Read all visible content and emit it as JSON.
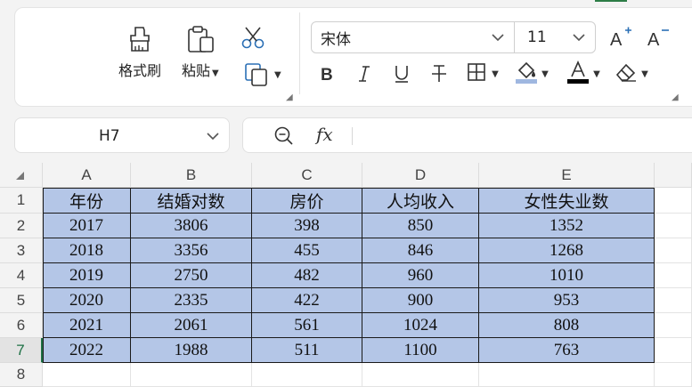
{
  "ribbon": {
    "format_painter_label": "格式刷",
    "paste_label": "粘贴",
    "font_name": "宋体",
    "font_size": "11",
    "icons": [
      "format-painter-icon",
      "paste-icon",
      "cut-icon",
      "copy-icon",
      "grow-font-icon",
      "shrink-font-icon",
      "bold-icon",
      "italic-icon",
      "underline-icon",
      "strikethrough-icon",
      "borders-icon",
      "fill-color-icon",
      "font-color-icon",
      "clear-icon"
    ],
    "colors": {
      "fill_swatch": "#9fb7e0",
      "font_color_swatch": "#000000"
    }
  },
  "namebox": {
    "value": "H7"
  },
  "formula": {
    "fx_label": "fx",
    "value": ""
  },
  "sheet": {
    "columns": [
      "A",
      "B",
      "C",
      "D",
      "E"
    ],
    "rows": [
      "1",
      "2",
      "3",
      "4",
      "5",
      "6",
      "7",
      "8"
    ],
    "active_row": "7",
    "header": [
      "年份",
      "结婚对数",
      "房价",
      "人均收入",
      "女性失业数"
    ],
    "data": [
      [
        "2017",
        "3806",
        "398",
        "850",
        "1352"
      ],
      [
        "2018",
        "3356",
        "455",
        "846",
        "1268"
      ],
      [
        "2019",
        "2750",
        "482",
        "960",
        "1010"
      ],
      [
        "2020",
        "2335",
        "422",
        "900",
        "953"
      ],
      [
        "2021",
        "2061",
        "561",
        "1024",
        "808"
      ],
      [
        "2022",
        "1988",
        "511",
        "1100",
        "763"
      ]
    ],
    "fill_color": "#b4c6e7"
  }
}
